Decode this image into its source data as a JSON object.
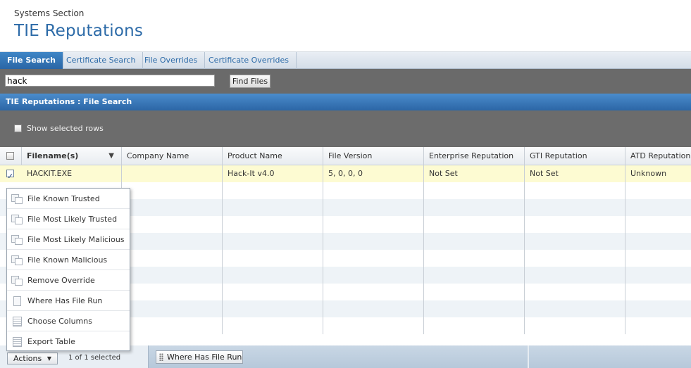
{
  "header": {
    "section": "Systems Section",
    "title": "TIE Reputations"
  },
  "tabs": [
    {
      "label": "File Search",
      "active": true
    },
    {
      "label": "Certificate Search",
      "active": false
    },
    {
      "label": "File Overrides",
      "active": false
    },
    {
      "label": "Certificate Overrides",
      "active": false
    }
  ],
  "search": {
    "value": "hack",
    "button_label": "Find Files"
  },
  "panel": {
    "title": "TIE Reputations : File Search"
  },
  "toolbar": {
    "show_selected_label": "Show selected rows",
    "show_selected_checked": false
  },
  "table": {
    "columns": [
      "Filename(s)",
      "Company Name",
      "Product Name",
      "File Version",
      "Enterprise Reputation",
      "GTI Reputation",
      "ATD Reputation"
    ],
    "rows": [
      {
        "checked": true,
        "cells": [
          "HACKIT.EXE",
          "",
          "Hack-It v4.0",
          "5, 0, 0, 0",
          "Not Set",
          "Not Set",
          "Unknown"
        ]
      }
    ]
  },
  "actions_menu": {
    "items": [
      {
        "label": "File Known Trusted",
        "icon": "override-icon"
      },
      {
        "label": "File Most Likely Trusted",
        "icon": "override-icon"
      },
      {
        "label": "File Most Likely Malicious",
        "icon": "override-icon"
      },
      {
        "label": "File Known Malicious",
        "icon": "override-icon"
      },
      {
        "label": "Remove Override",
        "icon": "override-icon"
      },
      {
        "label": "Where Has File Run",
        "icon": "document-icon"
      },
      {
        "label": "Choose Columns",
        "icon": "list-icon"
      },
      {
        "label": "Export Table",
        "icon": "list-icon"
      }
    ]
  },
  "footer": {
    "actions_label": "Actions",
    "selected_count": "1 of 1 selected",
    "where_run_label": "Where Has File Run"
  }
}
